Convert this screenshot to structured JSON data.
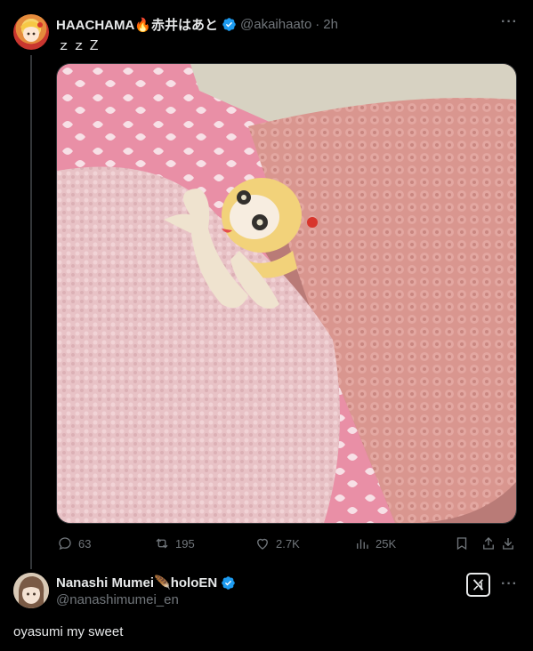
{
  "tweet": {
    "display_name": "HAACHAMA🔥赤井はあと",
    "handle": "@akaihaato",
    "separator": "·",
    "time": "2h",
    "text": "ｚｚＺ",
    "more_icon": "more-dots-icon",
    "media_alt": "Yellow-haired plush doll tucked under pink fluffy blanket on a pink pillow",
    "actions": {
      "replies": "63",
      "reposts": "195",
      "likes": "2.7K",
      "views": "25K"
    }
  },
  "reply": {
    "display_name": "Nanashi Mumei🪶holoEN",
    "handle": "@nanashimumei_en",
    "text": "oyasumi my sweet",
    "grok_icon": "grok-icon"
  },
  "colors": {
    "background": "#000000",
    "text": "#e7e9ea",
    "muted": "#71767b",
    "verified": "#1d9bf0"
  }
}
